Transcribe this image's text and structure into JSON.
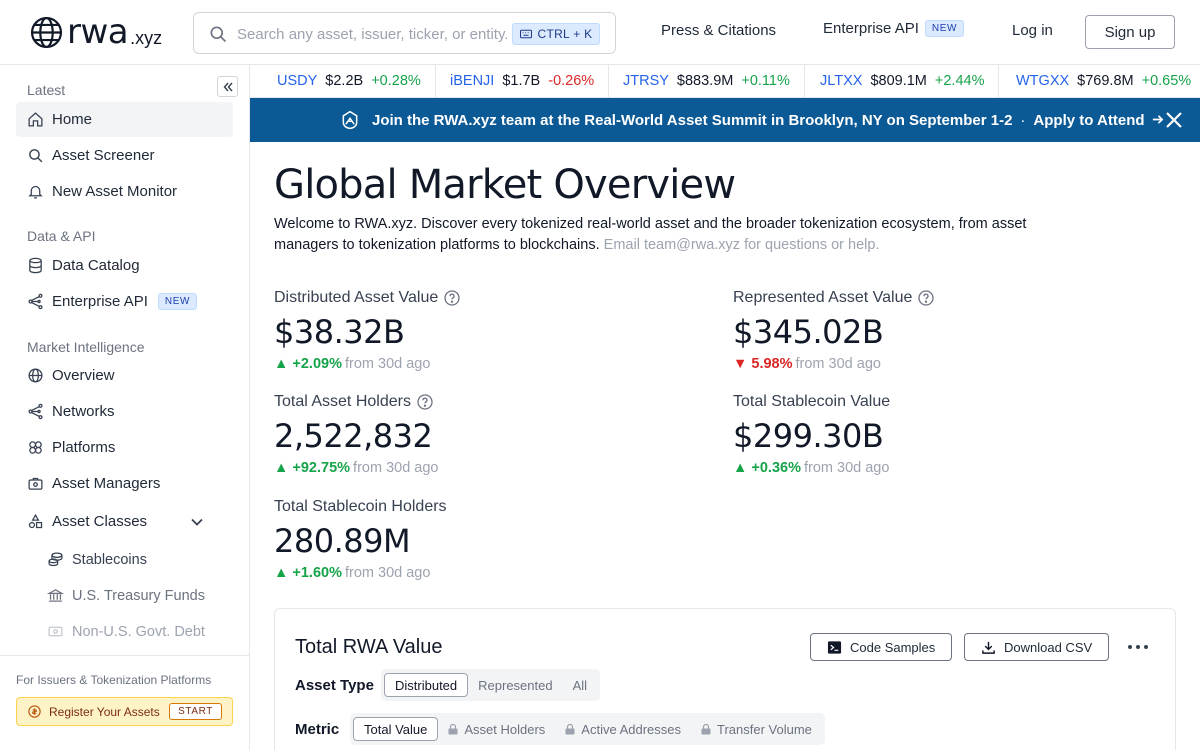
{
  "header": {
    "logo_text": "rwa",
    "logo_tld": ".xyz",
    "search_placeholder": "Search any asset, issuer, ticker, or entity...",
    "search_shortcut": "CTRL + K",
    "nav": {
      "press": "Press & Citations",
      "enterprise": "Enterprise API",
      "enterprise_badge": "NEW",
      "login": "Log in",
      "signup": "Sign up"
    }
  },
  "sidebar": {
    "sections": {
      "latest": "Latest",
      "data_api": "Data & API",
      "market_intel": "Market Intelligence"
    },
    "items": {
      "home": "Home",
      "screener": "Asset Screener",
      "monitor": "New Asset Monitor",
      "catalog": "Data Catalog",
      "enterprise": "Enterprise API",
      "enterprise_badge": "NEW",
      "overview": "Overview",
      "networks": "Networks",
      "platforms": "Platforms",
      "managers": "Asset Managers",
      "classes": "Asset Classes",
      "stablecoins": "Stablecoins",
      "treasury": "U.S. Treasury Funds",
      "nonus": "Non-U.S. Govt. Debt"
    },
    "footer": {
      "label": "For Issuers & Tokenization Platforms",
      "register": "Register Your Assets",
      "badge": "START"
    }
  },
  "ticker": [
    {
      "sym": "USDY",
      "val": "$2.2B",
      "chg": "+0.28%",
      "dir": "up"
    },
    {
      "sym": "iBENJI",
      "val": "$1.7B",
      "chg": "-0.26%",
      "dir": "down"
    },
    {
      "sym": "JTRSY",
      "val": "$883.9M",
      "chg": "+0.11%",
      "dir": "up"
    },
    {
      "sym": "JLTXX",
      "val": "$809.1M",
      "chg": "+2.44%",
      "dir": "up"
    },
    {
      "sym": "WTGXX",
      "val": "$769.8M",
      "chg": "+0.65%",
      "dir": "up"
    }
  ],
  "banner": {
    "text": "Join the RWA.xyz team at the Real-World Asset Summit in Brooklyn, NY on September 1-2",
    "separator": "·",
    "cta": "Apply to Attend"
  },
  "main": {
    "title": "Global Market Overview",
    "intro": "Welcome to RWA.xyz. Discover every tokenized real-world asset and the broader tokenization ecosystem, from asset managers to tokenization platforms to blockchains.",
    "intro_contact": "Email team@rwa.xyz for questions or help.",
    "from_text": "from 30d ago",
    "stats": {
      "distributed": {
        "label": "Distributed Asset Value",
        "value": "$38.32B",
        "change": "+2.09%",
        "dir": "up"
      },
      "represented": {
        "label": "Represented Asset Value",
        "value": "$345.02B",
        "change": "5.98%",
        "dir": "down"
      },
      "holders": {
        "label": "Total Asset Holders",
        "value": "2,522,832",
        "change": "+92.75%",
        "dir": "up"
      },
      "stable_value": {
        "label": "Total Stablecoin Value",
        "value": "$299.30B",
        "change": "+0.36%",
        "dir": "up"
      },
      "stable_holders": {
        "label": "Total Stablecoin Holders",
        "value": "280.89M",
        "change": "+1.60%",
        "dir": "up"
      }
    }
  },
  "card": {
    "title": "Total RWA Value",
    "code_samples": "Code Samples",
    "download_csv": "Download CSV",
    "asset_type_label": "Asset Type",
    "asset_type_options": [
      "Distributed",
      "Represented",
      "All"
    ],
    "asset_type_selected": "Distributed",
    "metric_label": "Metric",
    "metric_options": [
      "Total Value",
      "Asset Holders",
      "Active Addresses",
      "Transfer Volume"
    ],
    "metric_selected": "Total Value"
  },
  "colors": {
    "accent": "#2563eb",
    "banner_bg": "#0b5a96",
    "positive": "#16a34a",
    "negative": "#dc2626",
    "register_bg": "#fef3c7"
  },
  "icons": {
    "logo": "globe-icon",
    "search": "search-icon",
    "keyboard": "keyboard-icon",
    "collapse": "chevrons-left-icon",
    "home": "home-icon",
    "screener": "search-icon",
    "monitor": "bell-icon",
    "catalog": "database-icon",
    "enterprise": "network-icon",
    "overview": "globe-icon",
    "networks": "network-icon",
    "platforms": "platform-icon",
    "managers": "briefcase-icon",
    "classes": "shapes-icon",
    "stablecoins": "coins-icon",
    "treasury": "bank-icon",
    "nonus": "bill-icon",
    "register": "coin-icon",
    "banner": "summit-icon",
    "close": "close-icon",
    "help": "help-circle-icon",
    "code": "terminal-icon",
    "download": "download-icon",
    "more": "more-horizontal-icon",
    "lock": "lock-icon"
  }
}
